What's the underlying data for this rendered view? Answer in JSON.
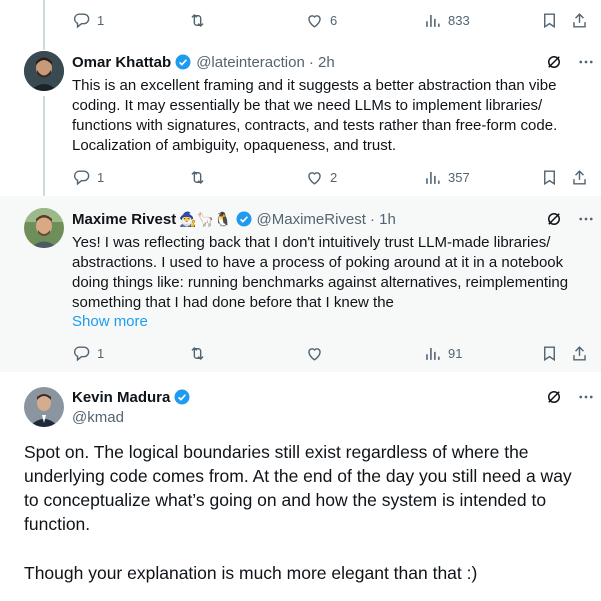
{
  "top_actions": {
    "replies": "1",
    "reposts": "",
    "likes": "6",
    "views": "833"
  },
  "tweets": [
    {
      "name": "Omar Khattab",
      "handle": "@lateinteraction",
      "time": "· 2h",
      "text": "This is an excellent framing and it suggests a better abstraction than vibe coding. It may essentially be that we need LLMs to implement libraries/ functions with signatures, contracts, and tests rather than free-form code. Localization of ambiguity, opaqueness, and trust.",
      "replies": "1",
      "likes": "2",
      "views": "357"
    },
    {
      "name": "Maxime Rivest",
      "emojis": "🧙‍♂️🦙🐧",
      "handle": "@MaximeRivest",
      "time": "· 1h",
      "text": "Yes! I was reflecting back that I don't intuitively trust LLM-made libraries/ abstractions. I used to have a process of poking around at it in a notebook doing things like: running benchmarks against alternatives, reimplementing something that I had done before that I knew the",
      "show_more": "Show more",
      "replies": "1",
      "likes": "",
      "views": "91"
    }
  ],
  "main": {
    "name": "Kevin Madura",
    "handle": "@kmad",
    "text1": "Spot on. The logical boundaries still exist regardless of where the underlying code comes from. At the end of the day you still need a way to conceptualize what’s going on and how the system is intended to function.",
    "text2": "Though your explanation is much more elegant than that :)"
  },
  "colors": {
    "verified": "#1d9bf0",
    "muted": "#536471",
    "thread_line": "#cfd9de"
  },
  "icons": [
    "reply-icon",
    "repost-icon",
    "like-icon",
    "views-icon",
    "bookmark-icon",
    "share-icon",
    "grok-icon",
    "more-icon",
    "verified-badge-icon"
  ]
}
